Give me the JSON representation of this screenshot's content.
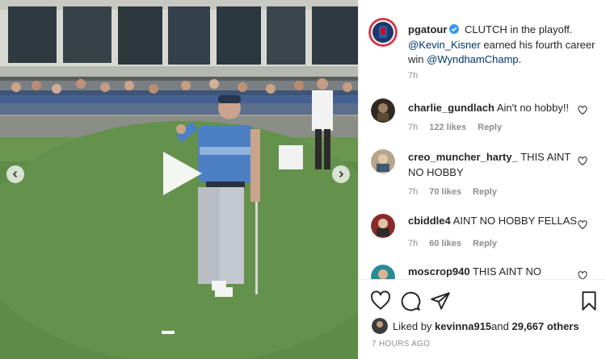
{
  "post": {
    "author": "pgatour",
    "caption_text": " CLUTCH in the playoff. ",
    "mention_player": "@Kevin_Kisner",
    "caption_middle": " earned his fourth career win ",
    "mention_event": "@WyndhamChamp",
    "caption_end": ".",
    "time_ago": "7h"
  },
  "comments": [
    {
      "user": "charlie_gundlach",
      "text": "Ain't no hobby!!",
      "time": "7h",
      "likes": "122 likes",
      "reply": "Reply"
    },
    {
      "user": "creo_muncher_harty_",
      "text": "THIS AINT NO HOBBY",
      "time": "7h",
      "likes": "70 likes",
      "reply": "Reply"
    },
    {
      "user": "cbiddle4",
      "text": "AINT NO HOBBY FELLAS",
      "time": "7h",
      "likes": "60 likes",
      "reply": "Reply"
    },
    {
      "user": "moscrop940",
      "text": "THIS AINT NO",
      "time": "",
      "likes": "",
      "reply": ""
    }
  ],
  "likes": {
    "prefix": "Liked by ",
    "user": "kevinna915",
    "middle": " and ",
    "count": "29,667 others"
  },
  "timestamp": "7 HOURS AGO",
  "icons": {
    "nav_left": "chevron-left-icon",
    "nav_right": "chevron-right-icon",
    "play": "play-icon",
    "like": "heart-icon",
    "comment": "comment-bubble-icon",
    "share": "send-icon",
    "save": "bookmark-icon"
  },
  "colors": {
    "mention": "#00376b",
    "verified": "#3897f0",
    "muted": "#8e8e8e"
  }
}
